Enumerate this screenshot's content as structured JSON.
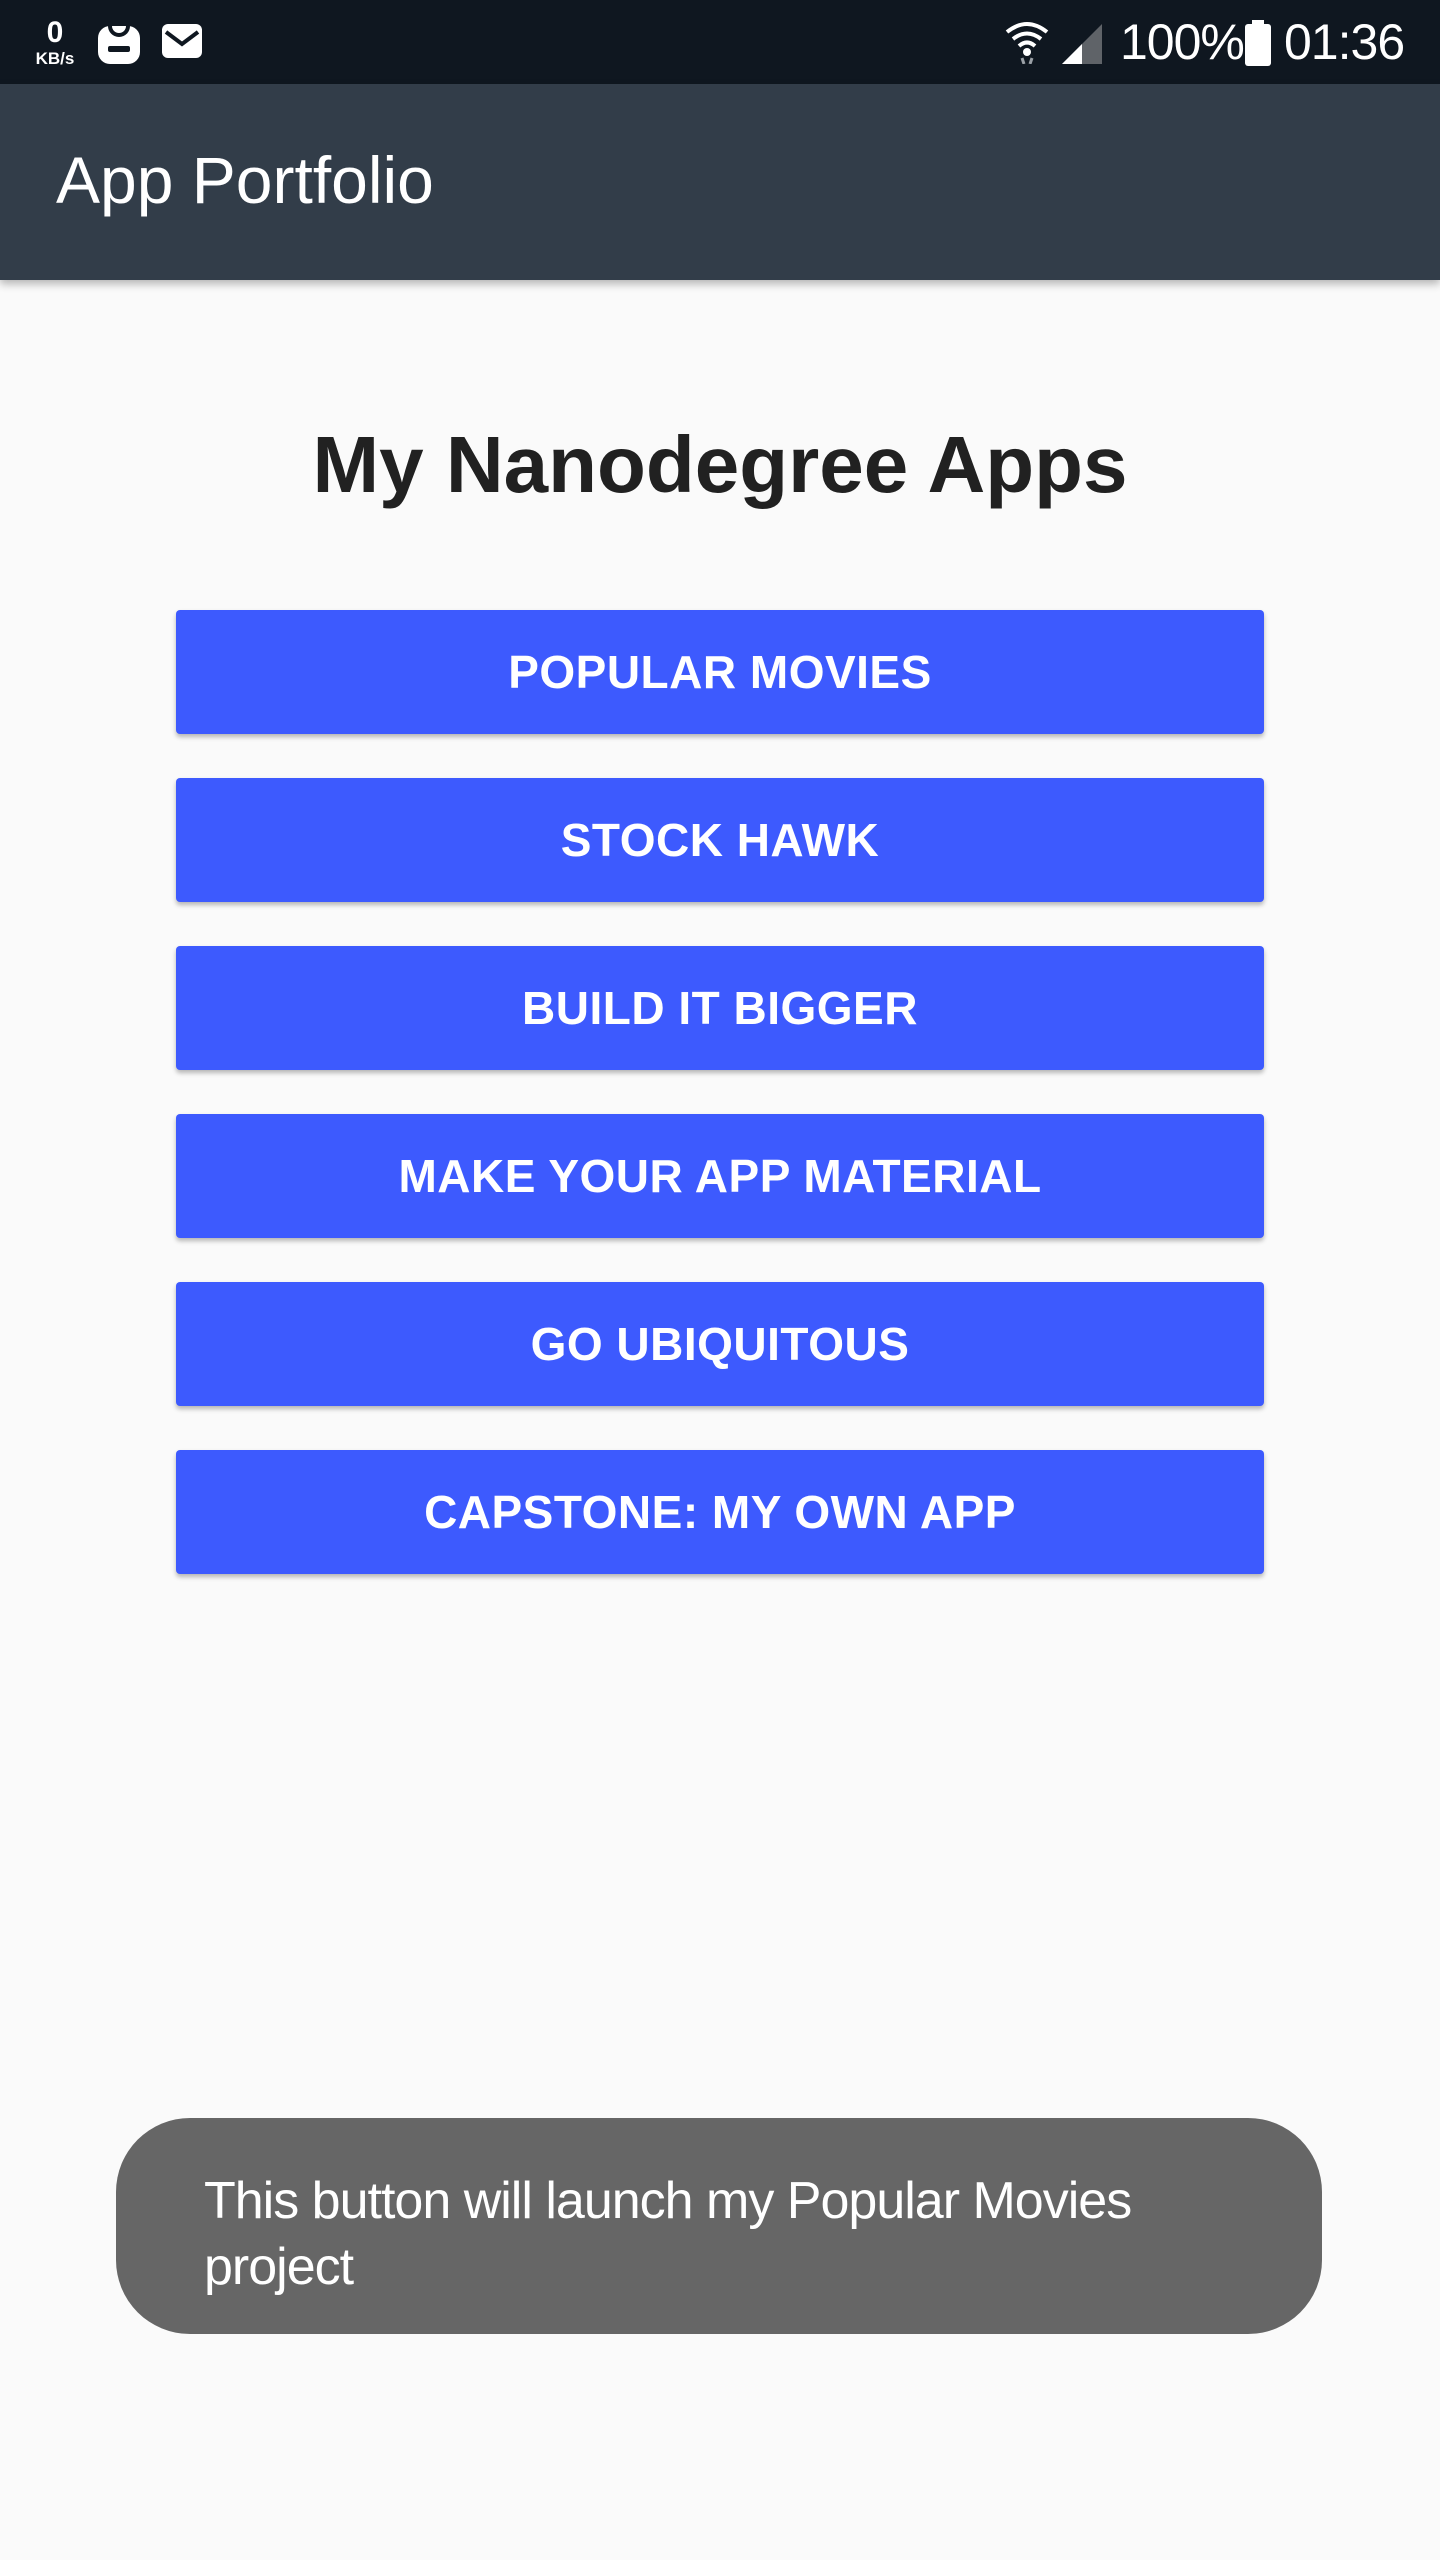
{
  "status_bar": {
    "net_speed_value": "0",
    "net_speed_unit": "KB/s",
    "battery": "100%",
    "time": "01:36",
    "icons": [
      "galaxy-store-icon",
      "mail-icon",
      "wifi-icon",
      "signal-icon",
      "battery-icon"
    ]
  },
  "app_bar": {
    "title": "App Portfolio"
  },
  "main": {
    "heading": "My Nanodegree Apps",
    "buttons": [
      {
        "label": "POPULAR MOVIES"
      },
      {
        "label": "STOCK HAWK"
      },
      {
        "label": "BUILD IT BIGGER"
      },
      {
        "label": "MAKE YOUR APP MATERIAL"
      },
      {
        "label": "GO UBIQUITOUS"
      },
      {
        "label": "CAPSTONE: MY OWN APP"
      }
    ]
  },
  "toast": {
    "message": "This button will launch my Popular Movies project"
  },
  "colors": {
    "status_bar": "#0f1720",
    "app_bar": "#323d49",
    "background": "#fafafa",
    "button": "#3d5afe",
    "toast": "#666666"
  }
}
